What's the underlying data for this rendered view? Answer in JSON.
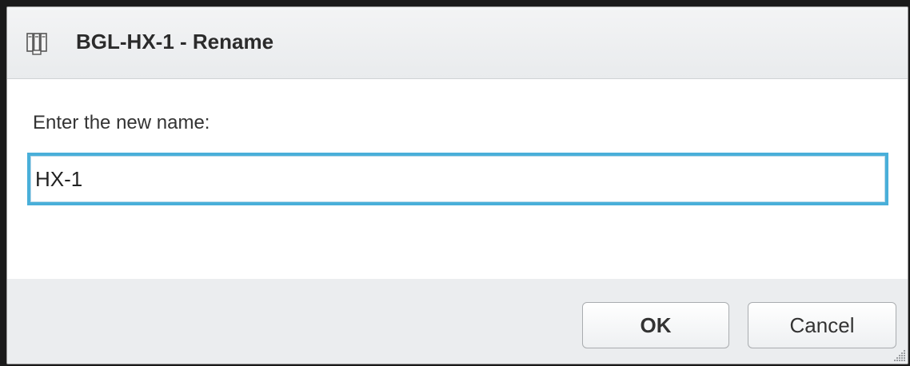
{
  "dialog": {
    "title": "BGL-HX-1 - Rename",
    "title_icon": "host-cluster-icon",
    "prompt": "Enter the new name:",
    "name_input": {
      "value": "HX-1",
      "focused": true
    },
    "buttons": {
      "ok_label": "OK",
      "cancel_label": "Cancel"
    }
  },
  "colors": {
    "focus_border": "#49afd9",
    "footer_bg": "#ebedef",
    "titlebar_bg": "#eceef0"
  }
}
